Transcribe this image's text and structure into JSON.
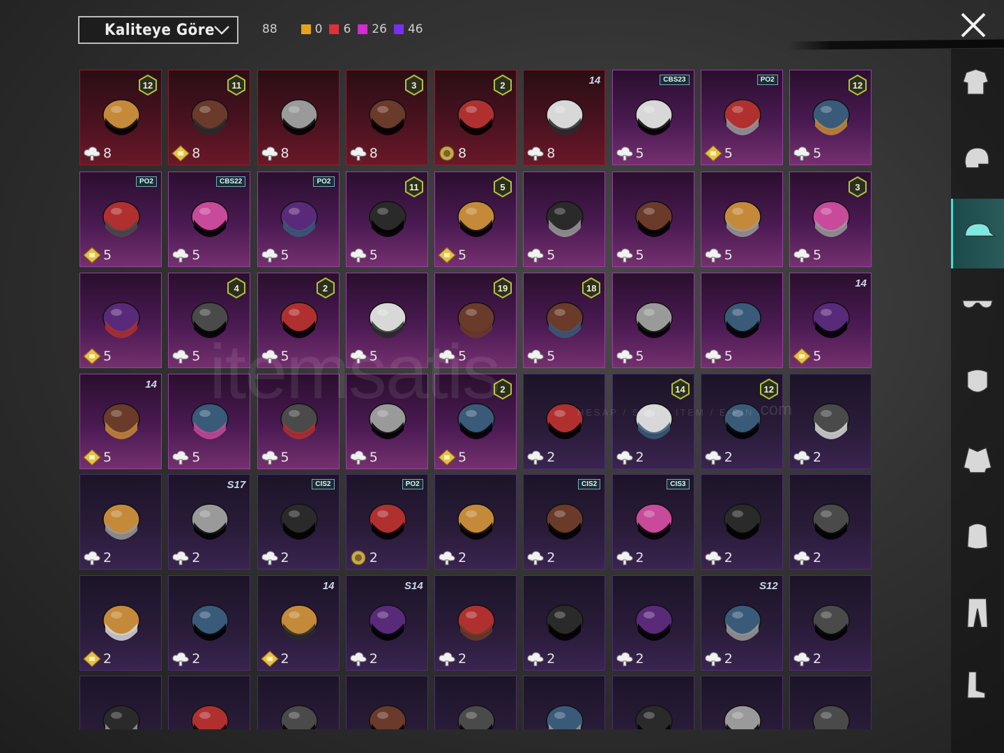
{
  "header": {
    "sort_label": "Kaliteye Göre",
    "total_count": "88",
    "counts": [
      {
        "color": "#e8a21a",
        "value": "0"
      },
      {
        "color": "#e0303a",
        "value": "6"
      },
      {
        "color": "#d22bd0",
        "value": "26"
      },
      {
        "color": "#7a2ef0",
        "value": "46"
      }
    ]
  },
  "watermark": {
    "brand": "itemsatis",
    "sub": "HESAP / SKIN / ITEM / E-PIN",
    "tld": ".com"
  },
  "rows": [
    [
      {
        "rarity": "red",
        "badge": "12",
        "badge_type": "hex",
        "qty": "8",
        "icon": "cloud",
        "art": "gray-wavy-hair"
      },
      {
        "rarity": "red",
        "badge": "11",
        "badge_type": "hex",
        "qty": "8",
        "icon": "diamond",
        "art": "black-helmet"
      },
      {
        "rarity": "red",
        "badge": "",
        "badge_type": "",
        "qty": "8",
        "icon": "cloud",
        "art": "red-gold-helmet"
      },
      {
        "rarity": "red",
        "badge": "3",
        "badge_type": "hex",
        "qty": "8",
        "icon": "cloud",
        "art": "fries-hat"
      },
      {
        "rarity": "red",
        "badge": "2",
        "badge_type": "hex",
        "qty": "8",
        "icon": "coin",
        "art": "samurai-helmet"
      },
      {
        "rarity": "red",
        "badge": "14",
        "badge_type": "season",
        "qty": "8",
        "icon": "cloud",
        "art": "purple-flower-hat"
      },
      {
        "rarity": "pink",
        "badge": "CBS23",
        "badge_type": "tag",
        "qty": "5",
        "icon": "cloud",
        "art": "cat-headphones"
      },
      {
        "rarity": "pink",
        "badge": "PO2",
        "badge_type": "tag",
        "qty": "5",
        "icon": "diamond",
        "art": "cap-with-goggles"
      },
      {
        "rarity": "pink",
        "badge": "12",
        "badge_type": "hex",
        "qty": "5",
        "icon": "cloud",
        "art": "orange-hair"
      }
    ],
    [
      {
        "rarity": "pink",
        "badge": "PO2",
        "badge_type": "tag",
        "qty": "5",
        "icon": "diamond",
        "art": "llama-head"
      },
      {
        "rarity": "pink",
        "badge": "CBS22",
        "badge_type": "tag",
        "qty": "5",
        "icon": "cloud",
        "art": "pink-blue-hair"
      },
      {
        "rarity": "pink",
        "badge": "PO2",
        "badge_type": "tag",
        "qty": "5",
        "icon": "cloud",
        "art": "panda-head"
      },
      {
        "rarity": "pink",
        "badge": "11",
        "badge_type": "hex",
        "qty": "5",
        "icon": "cloud",
        "art": "flower-veil-hair"
      },
      {
        "rarity": "pink",
        "badge": "5",
        "badge_type": "hex",
        "qty": "5",
        "icon": "diamond",
        "art": "brown-long-hair"
      },
      {
        "rarity": "pink",
        "badge": "",
        "badge_type": "",
        "qty": "5",
        "icon": "cloud",
        "art": "mohawk-helmet"
      },
      {
        "rarity": "pink",
        "badge": "",
        "badge_type": "",
        "qty": "5",
        "icon": "cloud",
        "art": "tribal-mask"
      },
      {
        "rarity": "pink",
        "badge": "",
        "badge_type": "",
        "qty": "5",
        "icon": "cloud",
        "art": "yellow-mech-helmet"
      },
      {
        "rarity": "pink",
        "badge": "3",
        "badge_type": "hex",
        "qty": "5",
        "icon": "cloud",
        "art": "ufo-hat"
      }
    ],
    [
      {
        "rarity": "pink",
        "badge": "",
        "badge_type": "",
        "qty": "5",
        "icon": "diamond",
        "art": "white-fluffy-hair"
      },
      {
        "rarity": "pink",
        "badge": "4",
        "badge_type": "hex",
        "qty": "5",
        "icon": "cloud",
        "art": "skull-dreads"
      },
      {
        "rarity": "pink",
        "badge": "2",
        "badge_type": "hex",
        "qty": "5",
        "icon": "cloud",
        "art": "predator-mask"
      },
      {
        "rarity": "pink",
        "badge": "",
        "badge_type": "",
        "qty": "5",
        "icon": "cloud",
        "art": "winged-helmet"
      },
      {
        "rarity": "pink",
        "badge": "19",
        "badge_type": "hex",
        "qty": "5",
        "icon": "cloud",
        "art": "bug-eyes-helmet"
      },
      {
        "rarity": "pink",
        "badge": "18",
        "badge_type": "hex",
        "qty": "5",
        "icon": "cloud",
        "art": "pink-cap-headphones"
      },
      {
        "rarity": "pink",
        "badge": "",
        "badge_type": "",
        "qty": "5",
        "icon": "cloud",
        "art": "lion-dreads"
      },
      {
        "rarity": "pink",
        "badge": "",
        "badge_type": "",
        "qty": "5",
        "icon": "cloud",
        "art": "zebra-head"
      },
      {
        "rarity": "pink",
        "badge": "14",
        "badge_type": "season",
        "qty": "5",
        "icon": "diamond",
        "art": "officer-cap"
      }
    ],
    [
      {
        "rarity": "pink",
        "badge": "14",
        "badge_type": "season",
        "qty": "5",
        "icon": "diamond",
        "art": "spiked-cap"
      },
      {
        "rarity": "pink",
        "badge": "",
        "badge_type": "",
        "qty": "5",
        "icon": "cloud",
        "art": "dragon-helmet"
      },
      {
        "rarity": "pink",
        "badge": "",
        "badge_type": "",
        "qty": "5",
        "icon": "cloud",
        "art": "dino-head"
      },
      {
        "rarity": "pink",
        "badge": "",
        "badge_type": "",
        "qty": "5",
        "icon": "cloud",
        "art": "sun-hat"
      },
      {
        "rarity": "pink",
        "badge": "2",
        "badge_type": "hex",
        "qty": "5",
        "icon": "diamond",
        "art": "rabbit-head"
      },
      {
        "rarity": "purple",
        "badge": "",
        "badge_type": "",
        "qty": "2",
        "icon": "cloud",
        "art": "black-hair"
      },
      {
        "rarity": "purple",
        "badge": "14",
        "badge_type": "hex",
        "qty": "2",
        "icon": "cloud",
        "art": "brown-hair-bow"
      },
      {
        "rarity": "purple",
        "badge": "12",
        "badge_type": "hex",
        "qty": "2",
        "icon": "cloud",
        "art": "bunny-ear-helmet"
      },
      {
        "rarity": "purple",
        "badge": "",
        "badge_type": "",
        "qty": "2",
        "icon": "cloud",
        "art": "red-hair-goggles"
      }
    ],
    [
      {
        "rarity": "purple",
        "badge": "",
        "badge_type": "",
        "qty": "2",
        "icon": "cloud",
        "art": "black-cap"
      },
      {
        "rarity": "purple",
        "badge": "S17",
        "badge_type": "season",
        "qty": "2",
        "icon": "cloud",
        "art": "horned-helmet"
      },
      {
        "rarity": "purple",
        "badge": "CIS2",
        "badge_type": "tag",
        "qty": "2",
        "icon": "cloud",
        "art": "striped-bandana"
      },
      {
        "rarity": "purple",
        "badge": "PO2",
        "badge_type": "tag",
        "qty": "2",
        "icon": "coin",
        "art": "gray-bob-hair"
      },
      {
        "rarity": "purple",
        "badge": "",
        "badge_type": "",
        "qty": "2",
        "icon": "cloud",
        "art": "braided-hair"
      },
      {
        "rarity": "purple",
        "badge": "CIS2",
        "badge_type": "tag",
        "qty": "2",
        "icon": "cloud",
        "art": "chef-hat-mask"
      },
      {
        "rarity": "purple",
        "badge": "CIS3",
        "badge_type": "tag",
        "qty": "2",
        "icon": "cloud",
        "art": "barrel-helmet"
      },
      {
        "rarity": "purple",
        "badge": "",
        "badge_type": "",
        "qty": "2",
        "icon": "cloud",
        "art": "brown-bob-hair"
      },
      {
        "rarity": "purple",
        "badge": "",
        "badge_type": "",
        "qty": "2",
        "icon": "cloud",
        "art": "dark-bob-hair"
      }
    ],
    [
      {
        "rarity": "purple",
        "badge": "",
        "badge_type": "",
        "qty": "2",
        "icon": "diamond",
        "art": "gray-cap"
      },
      {
        "rarity": "purple",
        "badge": "",
        "badge_type": "",
        "qty": "2",
        "icon": "cloud",
        "art": "camo-cap"
      },
      {
        "rarity": "purple",
        "badge": "14",
        "badge_type": "season",
        "qty": "2",
        "icon": "diamond",
        "art": "studded-cap"
      },
      {
        "rarity": "purple",
        "badge": "S14",
        "badge_type": "season",
        "qty": "2",
        "icon": "cloud",
        "art": "knight-helmet"
      },
      {
        "rarity": "purple",
        "badge": "",
        "badge_type": "",
        "qty": "2",
        "icon": "cloud",
        "art": "white-beanie"
      },
      {
        "rarity": "purple",
        "badge": "",
        "badge_type": "",
        "qty": "2",
        "icon": "cloud",
        "art": "pink-spike-helmet"
      },
      {
        "rarity": "purple",
        "badge": "",
        "badge_type": "",
        "qty": "2",
        "icon": "cloud",
        "art": "pink-cap"
      },
      {
        "rarity": "purple",
        "badge": "S12",
        "badge_type": "season",
        "qty": "2",
        "icon": "cloud",
        "art": "diving-helmet"
      },
      {
        "rarity": "purple",
        "badge": "",
        "badge_type": "",
        "qty": "2",
        "icon": "cloud",
        "art": "blue-bird-hood"
      }
    ],
    [
      {
        "rarity": "purple",
        "badge": "",
        "badge_type": "",
        "qty": "",
        "icon": "",
        "art": "knit-beanie"
      },
      {
        "rarity": "purple",
        "badge": "",
        "badge_type": "",
        "qty": "",
        "icon": "",
        "art": "turban"
      },
      {
        "rarity": "purple",
        "badge": "",
        "badge_type": "",
        "qty": "",
        "icon": "",
        "art": "blue-turban"
      },
      {
        "rarity": "purple",
        "badge": "",
        "badge_type": "",
        "qty": "",
        "icon": "",
        "art": "cat-ear-headband"
      },
      {
        "rarity": "purple",
        "badge": "",
        "badge_type": "",
        "qty": "",
        "icon": "",
        "art": "pirate-hat"
      },
      {
        "rarity": "purple",
        "badge": "",
        "badge_type": "",
        "qty": "",
        "icon": "",
        "art": "luchador-mask"
      },
      {
        "rarity": "purple",
        "badge": "",
        "badge_type": "",
        "qty": "",
        "icon": "",
        "art": "shark-hat"
      },
      {
        "rarity": "purple",
        "badge": "",
        "badge_type": "",
        "qty": "",
        "icon": "",
        "art": "red-beret"
      },
      {
        "rarity": "purple",
        "badge": "",
        "badge_type": "",
        "qty": "",
        "icon": "",
        "art": "black-top-hat"
      }
    ]
  ],
  "sidebar": [
    {
      "name": "outfit-icon"
    },
    {
      "name": "helmet-icon"
    },
    {
      "name": "cap-icon",
      "active": true
    },
    {
      "name": "glasses-icon"
    },
    {
      "name": "mask-icon"
    },
    {
      "name": "jacket-icon"
    },
    {
      "name": "backpack-icon"
    },
    {
      "name": "pants-icon"
    },
    {
      "name": "boots-icon"
    }
  ]
}
